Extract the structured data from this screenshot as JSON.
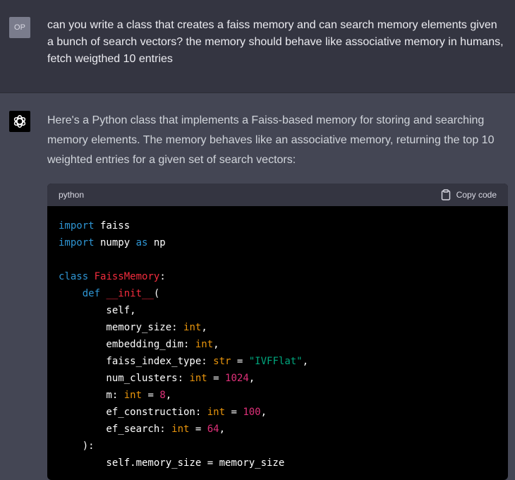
{
  "user": {
    "avatar_label": "OP",
    "message": "can you write a class that creates a faiss memory and can search memory elements given a bunch of search vectors? the memory should behave like associative memory in humans, fetch weigthed 10 entries"
  },
  "assistant": {
    "intro": "Here's a Python class that implements a Faiss-based memory for storing and searching memory elements. The memory behaves like an associative memory, returning the top 10 weighted entries for a given set of search vectors:"
  },
  "code_block": {
    "language": "python",
    "copy_label": "Copy code",
    "lines": [
      [
        {
          "t": "import",
          "c": "kw"
        },
        {
          "t": " faiss",
          "c": ""
        }
      ],
      [
        {
          "t": "import",
          "c": "kw"
        },
        {
          "t": " numpy ",
          "c": ""
        },
        {
          "t": "as",
          "c": "kw"
        },
        {
          "t": " np",
          "c": ""
        }
      ],
      [],
      [
        {
          "t": "class",
          "c": "kw"
        },
        {
          "t": " ",
          "c": ""
        },
        {
          "t": "FaissMemory",
          "c": "cls"
        },
        {
          "t": ":",
          "c": ""
        }
      ],
      [
        {
          "t": "    ",
          "c": ""
        },
        {
          "t": "def",
          "c": "kw"
        },
        {
          "t": " ",
          "c": ""
        },
        {
          "t": "__init__",
          "c": "fn"
        },
        {
          "t": "(",
          "c": ""
        }
      ],
      [
        {
          "t": "        self,",
          "c": ""
        }
      ],
      [
        {
          "t": "        memory_size: ",
          "c": ""
        },
        {
          "t": "int",
          "c": "bt"
        },
        {
          "t": ",",
          "c": ""
        }
      ],
      [
        {
          "t": "        embedding_dim: ",
          "c": ""
        },
        {
          "t": "int",
          "c": "bt"
        },
        {
          "t": ",",
          "c": ""
        }
      ],
      [
        {
          "t": "        faiss_index_type: ",
          "c": ""
        },
        {
          "t": "str",
          "c": "bt"
        },
        {
          "t": " = ",
          "c": ""
        },
        {
          "t": "\"IVFFlat\"",
          "c": "str"
        },
        {
          "t": ",",
          "c": ""
        }
      ],
      [
        {
          "t": "        num_clusters: ",
          "c": ""
        },
        {
          "t": "int",
          "c": "bt"
        },
        {
          "t": " = ",
          "c": ""
        },
        {
          "t": "1024",
          "c": "num"
        },
        {
          "t": ",",
          "c": ""
        }
      ],
      [
        {
          "t": "        m: ",
          "c": ""
        },
        {
          "t": "int",
          "c": "bt"
        },
        {
          "t": " = ",
          "c": ""
        },
        {
          "t": "8",
          "c": "num"
        },
        {
          "t": ",",
          "c": ""
        }
      ],
      [
        {
          "t": "        ef_construction: ",
          "c": ""
        },
        {
          "t": "int",
          "c": "bt"
        },
        {
          "t": " = ",
          "c": ""
        },
        {
          "t": "100",
          "c": "num"
        },
        {
          "t": ",",
          "c": ""
        }
      ],
      [
        {
          "t": "        ef_search: ",
          "c": ""
        },
        {
          "t": "int",
          "c": "bt"
        },
        {
          "t": " = ",
          "c": ""
        },
        {
          "t": "64",
          "c": "num"
        },
        {
          "t": ",",
          "c": ""
        }
      ],
      [
        {
          "t": "    ):",
          "c": ""
        }
      ],
      [
        {
          "t": "        self.memory_size = memory_size",
          "c": ""
        }
      ]
    ]
  }
}
